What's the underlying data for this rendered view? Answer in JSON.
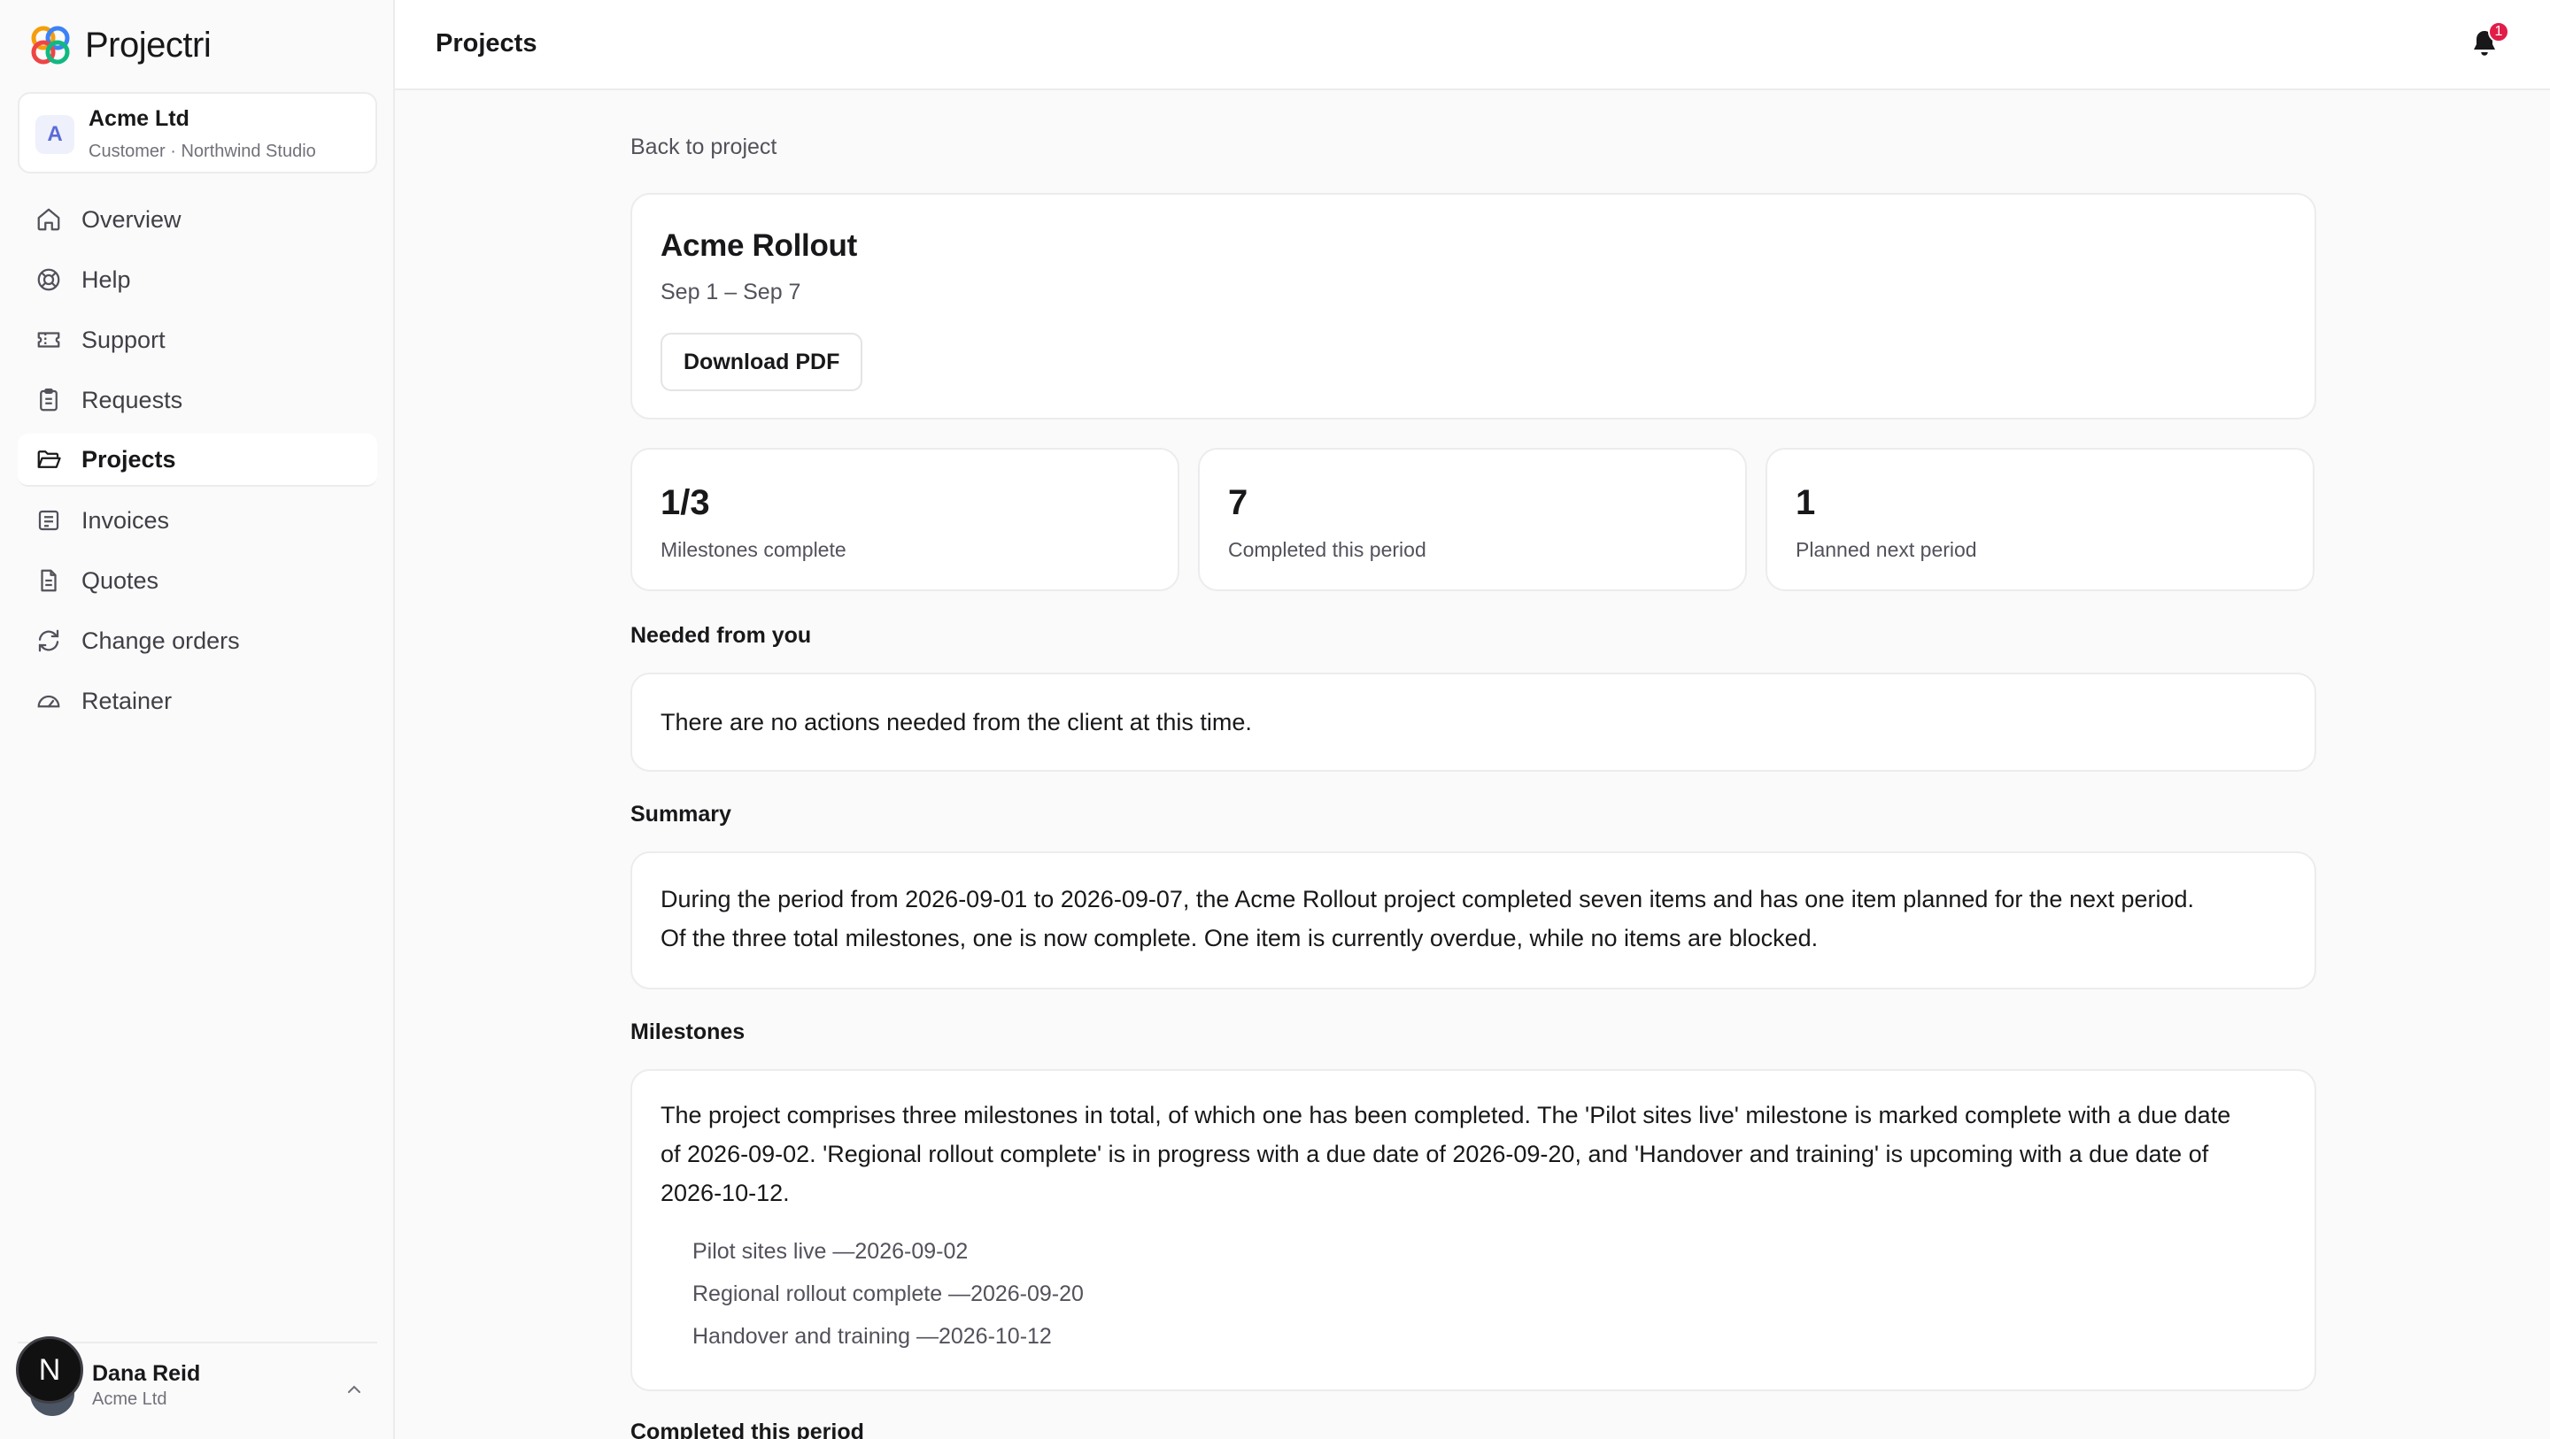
{
  "app": {
    "name": "Projectri",
    "org_name": "Acme Ltd",
    "org_sub": "Customer · Northwind Studio",
    "org_initial": "A"
  },
  "sidebar": {
    "items": [
      {
        "label": "Overview",
        "icon": "home-icon"
      },
      {
        "label": "Help",
        "icon": "lifebuoy-icon"
      },
      {
        "label": "Support",
        "icon": "ticket-icon"
      },
      {
        "label": "Requests",
        "icon": "clipboard-icon"
      },
      {
        "label": "Projects",
        "icon": "folder-open-icon",
        "active": true
      },
      {
        "label": "Invoices",
        "icon": "receipt-icon"
      },
      {
        "label": "Quotes",
        "icon": "file-text-icon"
      },
      {
        "label": "Change orders",
        "icon": "refresh-icon"
      },
      {
        "label": "Retainer",
        "icon": "gauge-icon"
      }
    ]
  },
  "user": {
    "name": "Dana Reid",
    "org": "Acme Ltd",
    "badge": "N"
  },
  "header": {
    "title": "Projects",
    "notification_count": "1"
  },
  "main": {
    "back_link": "Back to project",
    "project": {
      "title": "Acme Rollout",
      "dates": "Sep 1 – Sep 7",
      "download_label": "Download PDF"
    },
    "stats": [
      {
        "value": "1/3",
        "label": "Milestones complete"
      },
      {
        "value": "7",
        "label": "Completed this period"
      },
      {
        "value": "1",
        "label": "Planned next period"
      }
    ],
    "needed": {
      "title": "Needed from you",
      "text": "There are no actions needed from the client at this time."
    },
    "summary": {
      "title": "Summary",
      "line1": "During the period from 2026-09-01 to 2026-09-07, the Acme Rollout project completed seven items and has one item planned for the next period.",
      "line2": "Of the three total milestones, one is now complete. One item is currently overdue, while no items are blocked."
    },
    "milestones": {
      "title": "Milestones",
      "line1": "The project comprises three milestones in total, of which one has been completed. The 'Pilot sites live' milestone is marked complete with a due date",
      "line2": "of 2026-09-02. 'Regional rollout complete' is in progress with a due date of 2026-09-20, and 'Handover and training' is upcoming with a due date of",
      "line3": "2026-10-12.",
      "items": [
        {
          "name": "Pilot sites live",
          "date": "2026-09-02"
        },
        {
          "name": "Regional rollout complete",
          "date": "2026-09-20"
        },
        {
          "name": "Handover and training",
          "date": "2026-10-12"
        }
      ]
    },
    "completed": {
      "title": "Completed this period"
    }
  },
  "colors": {
    "accent": "#5b6bd6",
    "badge": "#e11d48",
    "border": "#ececee",
    "muted_text": "#71717a"
  }
}
